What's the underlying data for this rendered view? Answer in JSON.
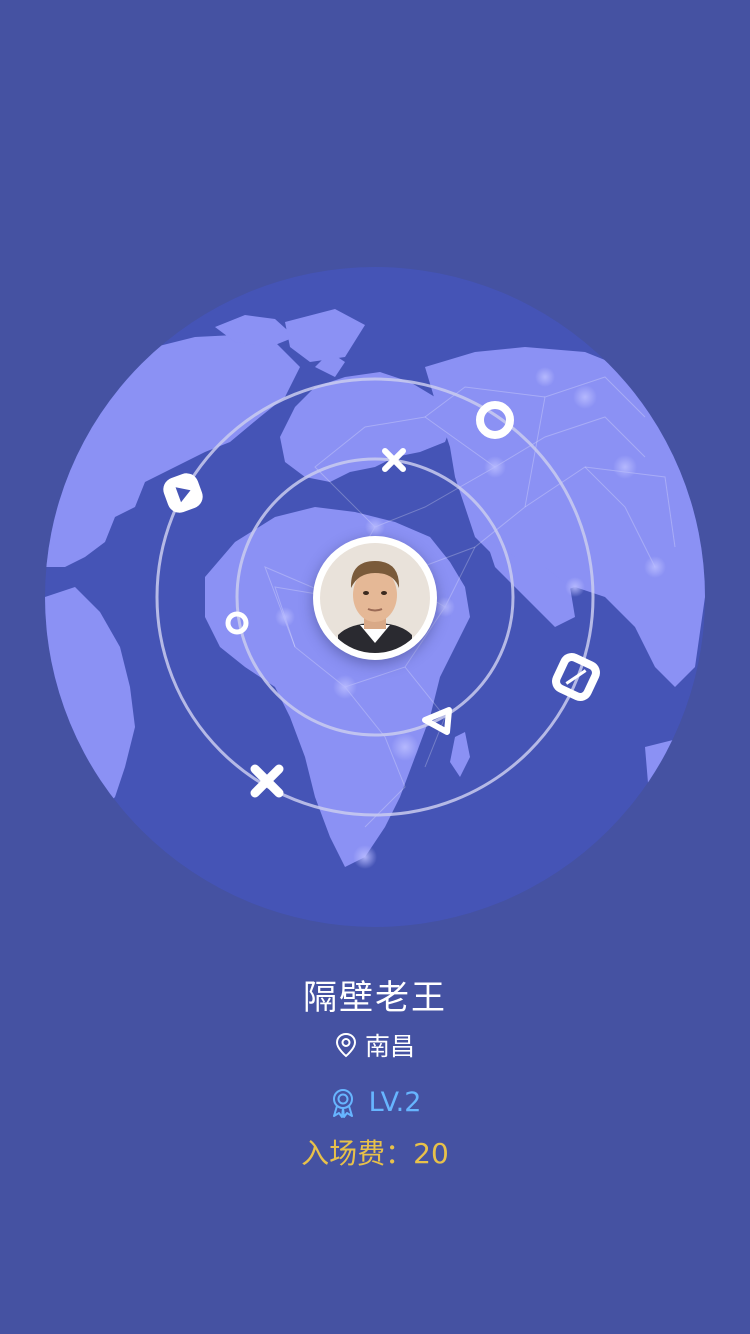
{
  "profile": {
    "username": "隔壁老王",
    "city": "南昌",
    "level": "LV.2",
    "entry_fee": "入场费：20"
  },
  "colors": {
    "background": "#4552a2",
    "globe": "#4554b6",
    "land": "#8b91f4",
    "orbit": "#c9cbef",
    "level_text": "#67b5ff",
    "fee_text": "#e8c14a"
  },
  "icons": {
    "location": "map-pin-icon",
    "level": "award-badge-icon",
    "orbit_markers": [
      "play-triangle-icon",
      "ring-icon",
      "cross-icon",
      "dot-ring-icon",
      "triangle-icon",
      "square-icon",
      "cross-icon"
    ]
  }
}
